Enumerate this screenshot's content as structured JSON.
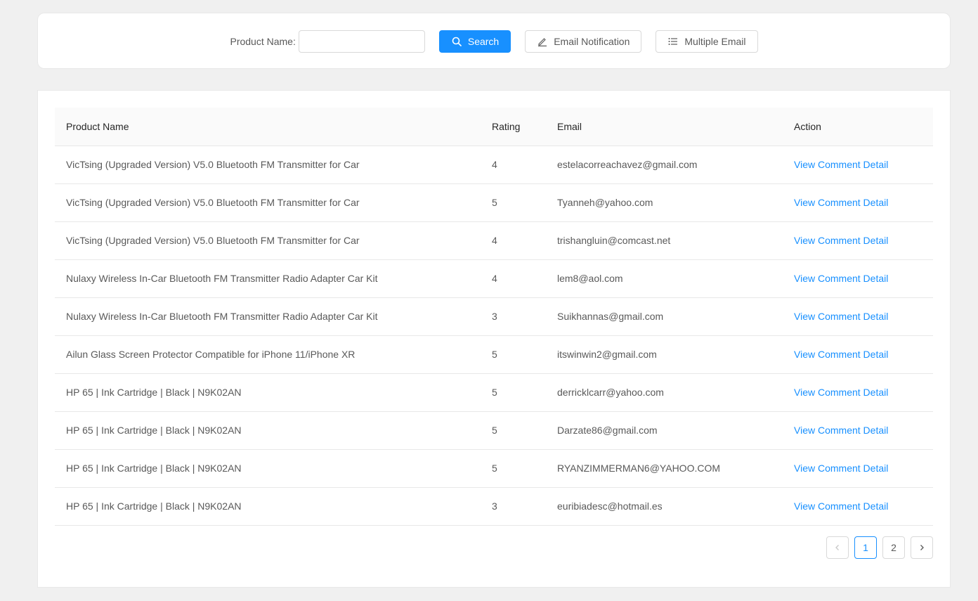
{
  "search": {
    "product_label": "Product Name:",
    "product_value": "",
    "product_placeholder": "",
    "search_button": "Search",
    "email_button": "Email Notification",
    "multiple_button": "Multiple Email"
  },
  "table": {
    "columns": [
      "Product Name",
      "Rating",
      "Email",
      "Action"
    ],
    "rows": [
      {
        "product": "VicTsing (Upgraded Version) V5.0 Bluetooth FM Transmitter for Car",
        "rating": "4",
        "email": "estelacorreachavez@gmail.com",
        "action": "View Comment Detail"
      },
      {
        "product": "VicTsing (Upgraded Version) V5.0 Bluetooth FM Transmitter for Car",
        "rating": "5",
        "email": "Tyanneh@yahoo.com",
        "action": "View Comment Detail"
      },
      {
        "product": "VicTsing (Upgraded Version) V5.0 Bluetooth FM Transmitter for Car",
        "rating": "4",
        "email": "trishangluin@comcast.net",
        "action": "View Comment Detail"
      },
      {
        "product": "Nulaxy Wireless In-Car Bluetooth FM Transmitter Radio Adapter Car Kit",
        "rating": "4",
        "email": "lem8@aol.com",
        "action": "View Comment Detail"
      },
      {
        "product": "Nulaxy Wireless In-Car Bluetooth FM Transmitter Radio Adapter Car Kit",
        "rating": "3",
        "email": "Suikhannas@gmail.com",
        "action": "View Comment Detail"
      },
      {
        "product": "Ailun Glass Screen Protector Compatible for iPhone 11/iPhone XR",
        "rating": "5",
        "email": "itswinwin2@gmail.com",
        "action": "View Comment Detail"
      },
      {
        "product": "HP 65 | Ink Cartridge | Black | N9K02AN",
        "rating": "5",
        "email": "derricklcarr@yahoo.com",
        "action": "View Comment Detail"
      },
      {
        "product": "HP 65 | Ink Cartridge | Black | N9K02AN",
        "rating": "5",
        "email": "Darzate86@gmail.com",
        "action": "View Comment Detail"
      },
      {
        "product": "HP 65 | Ink Cartridge | Black | N9K02AN",
        "rating": "5",
        "email": "RYANZIMMERMAN6@YAHOO.COM",
        "action": "View Comment Detail"
      },
      {
        "product": "HP 65 | Ink Cartridge | Black | N9K02AN",
        "rating": "3",
        "email": "euribiadesc@hotmail.es",
        "action": "View Comment Detail"
      }
    ]
  },
  "pagination": {
    "pages": [
      "1",
      "2"
    ],
    "current": "1",
    "prev_icon": "chevron-left-icon",
    "next_icon": "chevron-right-icon"
  },
  "colors": {
    "accent": "#1890ff",
    "background": "#f0f0f0"
  }
}
